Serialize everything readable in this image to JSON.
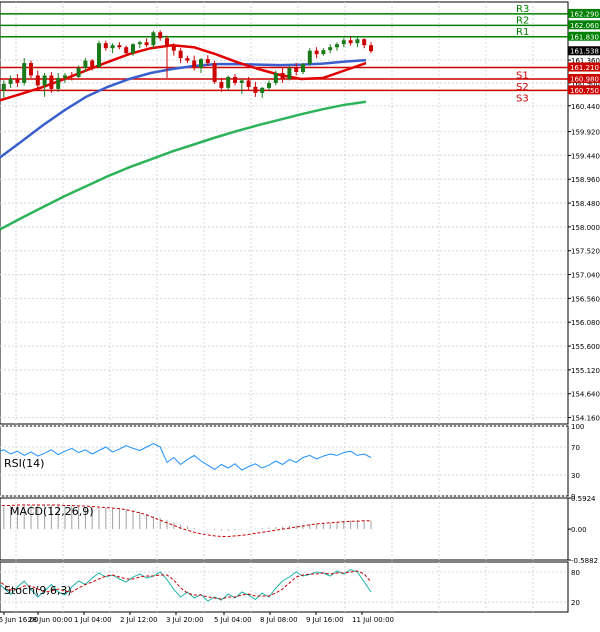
{
  "chart_data": {
    "type": "candlestick",
    "instrument_levels": {
      "R3": 162.29,
      "R2": 162.06,
      "R1": 161.83,
      "S1": 161.21,
      "S2": 160.98,
      "S3": 160.75,
      "current_price": 161.538
    },
    "level_names": [
      "R3",
      "R2",
      "R1",
      "S1",
      "S2",
      "S3"
    ],
    "price_axis_ticks": [
      "161.360",
      "160.900",
      "160.440",
      "159.920",
      "159.440",
      "158.960",
      "158.480",
      "158.000",
      "157.520",
      "157.040",
      "156.560",
      "156.080",
      "155.600",
      "155.120",
      "154.640",
      "154.160"
    ],
    "price_axis_tick_values": [
      161.36,
      160.9,
      160.44,
      159.92,
      159.44,
      158.96,
      158.48,
      158.0,
      157.52,
      157.04,
      156.56,
      156.08,
      155.6,
      155.12,
      154.64,
      154.16
    ],
    "price_labels": [
      "162.290",
      "162.060",
      "161.830",
      "161.538",
      "161.210",
      "160.980",
      "160.750"
    ],
    "time_axis_labels": [
      "26 Jun 16:00",
      "28 Jun 00:00",
      "1 Jul 04:00",
      "2 Jul 12:00",
      "3 Jul 20:00",
      "5 Jul 04:00",
      "8 Jul 08:00",
      "9 Jul 16:00",
      "11 Jul 00:00"
    ],
    "colors": {
      "bull_candle": "#1a7a1a",
      "bear_candle": "#cc0000",
      "resistance": "#008000",
      "support": "#cc0000",
      "ma_fast": "#e00000",
      "ma_mid": "#3a5fcd",
      "ma_slow": "#2db35a",
      "rsi": "#1e90ff",
      "macd_hist": "#a0a0a0",
      "macd_signal": "#cc0000",
      "stoch_main": "#20b2aa",
      "stoch_signal": "#cc0000",
      "grid": "#d0d8e0"
    },
    "candles": [
      [
        161.05,
        161.1,
        160.62,
        160.75
      ],
      [
        160.75,
        160.95,
        160.6,
        160.88
      ],
      [
        160.88,
        161.05,
        160.8,
        160.98
      ],
      [
        160.98,
        161.08,
        160.82,
        160.9
      ],
      [
        160.9,
        161.4,
        160.85,
        161.3
      ],
      [
        161.3,
        161.35,
        161.0,
        161.05
      ],
      [
        161.05,
        161.15,
        160.8,
        160.85
      ],
      [
        160.85,
        161.1,
        160.62,
        161.05
      ],
      [
        161.05,
        161.12,
        160.7,
        160.78
      ],
      [
        160.78,
        161.1,
        160.72,
        161.0
      ],
      [
        161.0,
        161.1,
        160.9,
        161.05
      ],
      [
        161.05,
        161.12,
        160.95,
        161.02
      ],
      [
        161.02,
        161.25,
        161.0,
        161.2
      ],
      [
        161.2,
        161.4,
        161.12,
        161.35
      ],
      [
        161.35,
        161.38,
        161.15,
        161.22
      ],
      [
        161.22,
        161.75,
        161.2,
        161.7
      ],
      [
        161.7,
        161.75,
        161.55,
        161.6
      ],
      [
        161.6,
        161.7,
        161.5,
        161.66
      ],
      [
        161.66,
        161.72,
        161.58,
        161.62
      ],
      [
        161.62,
        161.65,
        161.45,
        161.5
      ],
      [
        161.5,
        161.7,
        161.45,
        161.68
      ],
      [
        161.68,
        161.75,
        161.6,
        161.72
      ],
      [
        161.72,
        161.8,
        161.62,
        161.66
      ],
      [
        161.66,
        161.95,
        161.6,
        161.92
      ],
      [
        161.92,
        161.96,
        161.75,
        161.8
      ],
      [
        161.8,
        161.85,
        161.0,
        161.65
      ],
      [
        161.65,
        161.7,
        161.45,
        161.55
      ],
      [
        161.55,
        161.6,
        161.3,
        161.4
      ],
      [
        161.4,
        161.45,
        161.3,
        161.35
      ],
      [
        161.35,
        161.45,
        161.15,
        161.2
      ],
      [
        161.2,
        161.4,
        161.1,
        161.38
      ],
      [
        161.38,
        161.46,
        161.25,
        161.3
      ],
      [
        161.3,
        161.35,
        160.88,
        160.92
      ],
      [
        160.92,
        161.0,
        160.72,
        160.8
      ],
      [
        160.8,
        161.05,
        160.75,
        161.02
      ],
      [
        161.02,
        161.08,
        160.85,
        160.9
      ],
      [
        160.9,
        160.98,
        160.68,
        160.95
      ],
      [
        160.95,
        161.02,
        160.75,
        160.82
      ],
      [
        160.82,
        160.92,
        160.62,
        160.7
      ],
      [
        160.7,
        160.82,
        160.6,
        160.8
      ],
      [
        160.8,
        160.95,
        160.75,
        160.9
      ],
      [
        160.9,
        161.15,
        160.85,
        161.1
      ],
      [
        161.1,
        161.2,
        160.9,
        160.98
      ],
      [
        160.98,
        161.25,
        160.95,
        161.2
      ],
      [
        161.2,
        161.3,
        161.05,
        161.12
      ],
      [
        161.12,
        161.3,
        161.08,
        161.28
      ],
      [
        161.28,
        161.6,
        161.25,
        161.55
      ],
      [
        161.55,
        161.62,
        161.4,
        161.48
      ],
      [
        161.48,
        161.6,
        161.45,
        161.56
      ],
      [
        161.56,
        161.68,
        161.5,
        161.62
      ],
      [
        161.62,
        161.72,
        161.55,
        161.68
      ],
      [
        161.68,
        161.8,
        161.62,
        161.76
      ],
      [
        161.76,
        161.84,
        161.65,
        161.7
      ],
      [
        161.7,
        161.82,
        161.62,
        161.78
      ],
      [
        161.78,
        161.8,
        161.6,
        161.66
      ],
      [
        161.66,
        161.72,
        161.5,
        161.54
      ]
    ],
    "ma_fast": [
      160.55,
      160.68,
      160.82,
      160.98,
      161.15,
      161.32,
      161.48,
      161.6,
      161.66,
      161.62,
      161.48,
      161.32,
      161.18,
      161.06,
      160.98,
      161.0,
      161.15,
      161.3
    ],
    "ma_mid": [
      159.4,
      159.72,
      160.05,
      160.35,
      160.62,
      160.82,
      160.98,
      161.1,
      161.18,
      161.24,
      161.28,
      161.28,
      161.27,
      161.26,
      161.27,
      161.29,
      161.33,
      161.36
    ],
    "ma_slow": [
      157.95,
      158.18,
      158.4,
      158.62,
      158.82,
      159.02,
      159.2,
      159.36,
      159.52,
      159.66,
      159.8,
      159.93,
      160.05,
      160.16,
      160.27,
      160.37,
      160.46,
      160.52
    ],
    "rsi": {
      "label": "RSI(14)",
      "levels": [
        "70",
        "30",
        "100",
        "0"
      ],
      "values": [
        62,
        66,
        60,
        64,
        58,
        63,
        57,
        61,
        66,
        59,
        64,
        68,
        62,
        66,
        60,
        65,
        70,
        63,
        67,
        72,
        68,
        65,
        70,
        75,
        70,
        48,
        55,
        45,
        52,
        58,
        50,
        44,
        38,
        45,
        40,
        46,
        37,
        42,
        46,
        40,
        44,
        50,
        45,
        52,
        48,
        55,
        58,
        53,
        57,
        60,
        58,
        62,
        64,
        58,
        60,
        55
      ]
    },
    "macd": {
      "label": "MACD(12,26,9)",
      "levels": [
        "0.5924",
        "0.00",
        "-0.5882"
      ],
      "hist": [
        0.42,
        0.43,
        0.44,
        0.45,
        0.45,
        0.46,
        0.46,
        0.46,
        0.46,
        0.45,
        0.45,
        0.44,
        0.43,
        0.42,
        0.41,
        0.4,
        0.4,
        0.39,
        0.39,
        0.38,
        0.36,
        0.33,
        0.29,
        0.25,
        0.21,
        0.17,
        0.13,
        0.09,
        0.05,
        0.02,
        0.0,
        -0.01,
        -0.02,
        -0.03,
        -0.03,
        -0.02,
        -0.01,
        0.0,
        0.01,
        0.02,
        0.03,
        0.04,
        0.05,
        0.06,
        0.07,
        0.08,
        0.09,
        0.1,
        0.11,
        0.12,
        0.14,
        0.15,
        0.16,
        0.17,
        0.17,
        0.16
      ],
      "signal": [
        0.44,
        0.45,
        0.45,
        0.46,
        0.46,
        0.46,
        0.46,
        0.46,
        0.46,
        0.46,
        0.45,
        0.45,
        0.44,
        0.44,
        0.43,
        0.42,
        0.41,
        0.4,
        0.39,
        0.37,
        0.34,
        0.31,
        0.27,
        0.22,
        0.17,
        0.12,
        0.07,
        0.02,
        -0.02,
        -0.06,
        -0.09,
        -0.11,
        -0.13,
        -0.14,
        -0.14,
        -0.13,
        -0.12,
        -0.1,
        -0.08,
        -0.06,
        -0.04,
        -0.02,
        0.0,
        0.02,
        0.04,
        0.06,
        0.08,
        0.1,
        0.11,
        0.12,
        0.13,
        0.14,
        0.15,
        0.15,
        0.16,
        0.16
      ]
    },
    "stoch": {
      "label": "Stoch(9,6,3)",
      "levels": [
        "80",
        "20"
      ],
      "main": [
        60,
        48,
        35,
        50,
        62,
        45,
        30,
        42,
        55,
        40,
        34,
        50,
        62,
        55,
        68,
        78,
        70,
        74,
        66,
        60,
        70,
        76,
        68,
        72,
        80,
        65,
        45,
        30,
        40,
        28,
        35,
        22,
        30,
        24,
        36,
        28,
        40,
        34,
        25,
        38,
        30,
        48,
        62,
        70,
        80,
        72,
        75,
        80,
        78,
        72,
        82,
        76,
        85,
        80,
        60,
        40
      ],
      "signal": [
        64,
        55,
        44,
        45,
        52,
        52,
        46,
        40,
        42,
        46,
        42,
        40,
        48,
        55,
        60,
        66,
        72,
        74,
        70,
        66,
        66,
        70,
        72,
        72,
        74,
        74,
        64,
        48,
        38,
        34,
        34,
        30,
        28,
        26,
        30,
        30,
        34,
        36,
        32,
        32,
        32,
        38,
        46,
        58,
        70,
        74,
        76,
        76,
        78,
        76,
        78,
        78,
        80,
        82,
        76,
        60
      ]
    }
  }
}
